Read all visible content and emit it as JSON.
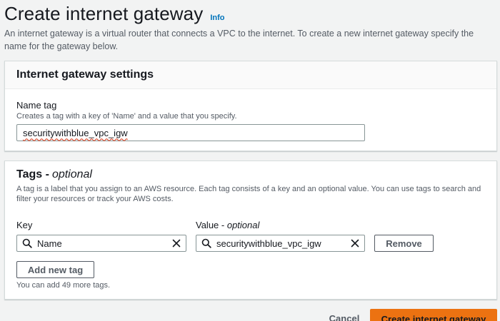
{
  "header": {
    "title": "Create internet gateway",
    "info_link": "Info",
    "description": "An internet gateway is a virtual router that connects a VPC to the internet. To create a new internet gateway specify the name for the gateway below."
  },
  "settings": {
    "title": "Internet gateway settings",
    "name_label": "Name tag",
    "name_desc": "Creates a tag with a key of 'Name' and a value that you specify.",
    "name_value": "securitywithblue_vpc_igw"
  },
  "tags": {
    "title": "Tags - ",
    "title_optional": "optional",
    "description": "A tag is a label that you assign to an AWS resource. Each tag consists of a key and an optional value. You can use tags to search and filter your resources or track your AWS costs.",
    "key_label": "Key",
    "value_label": "Value - ",
    "value_label_optional": "optional",
    "rows": [
      {
        "key": "Name",
        "value": "securitywithblue_vpc_igw"
      }
    ],
    "remove_button": "Remove",
    "add_button": "Add new tag",
    "hint": "You can add 49 more tags."
  },
  "footer": {
    "cancel": "Cancel",
    "create": "Create internet gateway"
  },
  "icons": {
    "search": "search-icon",
    "clear": "close-icon"
  },
  "colors": {
    "primary_button": "#ec7211",
    "link": "#0073bb",
    "background": "#f2f3f3"
  }
}
